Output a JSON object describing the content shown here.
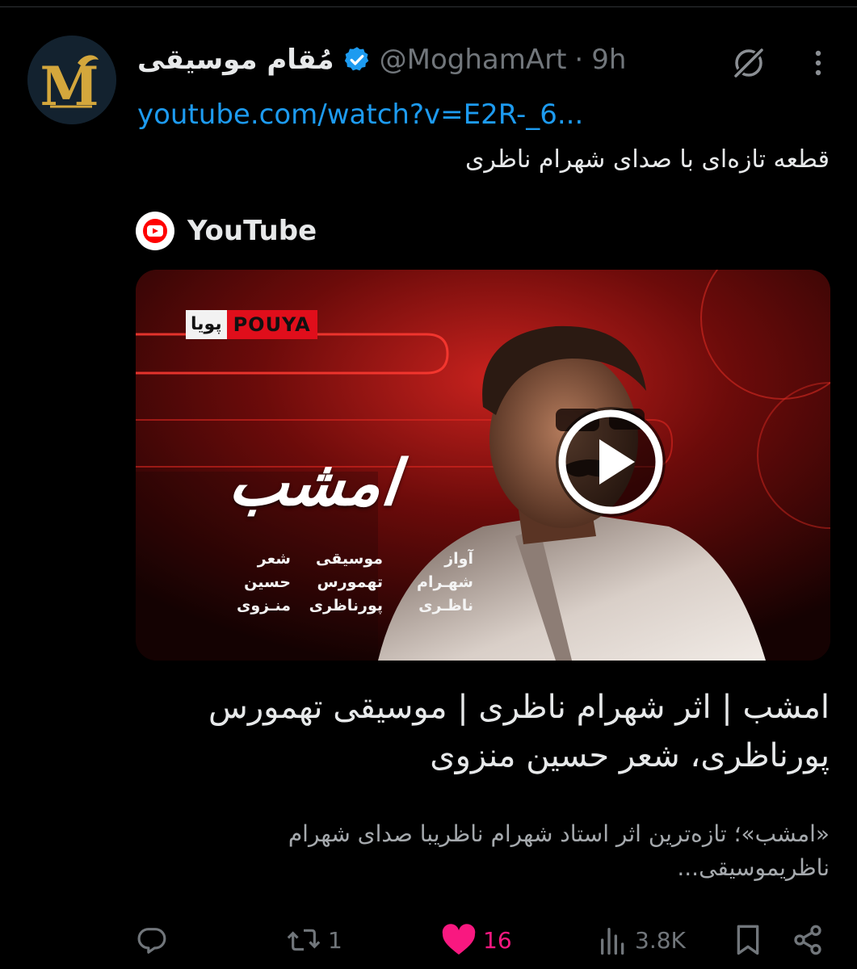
{
  "tweet": {
    "display_name": "مُقام موسیقی",
    "handle": "@MoghamArt",
    "separator": "·",
    "time": "9h",
    "avatar_letter": "M",
    "link": "youtube.com/watch?v=E2R-_6...",
    "text": "قطعه تازه‌ای با صدای شهرام ناظری"
  },
  "card": {
    "source_icon": "youtube-play-icon",
    "source_name": "YouTube",
    "thumbnail": {
      "brand_fa": "پویا",
      "brand_en": "POUYA",
      "song_title": "امشب",
      "credits": [
        {
          "role": "شعر",
          "line1": "حسین",
          "line2": "منـزوی"
        },
        {
          "role": "موسیقی",
          "line1": "تهمورس",
          "line2": "پورناظری"
        },
        {
          "role": "آواز",
          "line1": "شهـرام",
          "line2": "ناظـری"
        }
      ]
    },
    "title": "امشب | اثر شهرام ناظری | موسیقی تهمورس پورناظری، شعر حسین منزوی",
    "description": "«امشب»؛ تازه‌ترین اثر استاد شهرام ناظریبا صدای شهرام ناظریموسیقی..."
  },
  "actions": {
    "replies": "",
    "retweets": "1",
    "likes": "16",
    "views": "3.8K"
  },
  "colors": {
    "background": "#000000",
    "link": "#1d9bf0",
    "verified": "#1d9bf0",
    "like": "#f91880",
    "muted": "#71767b",
    "youtube_red": "#ff0000"
  }
}
